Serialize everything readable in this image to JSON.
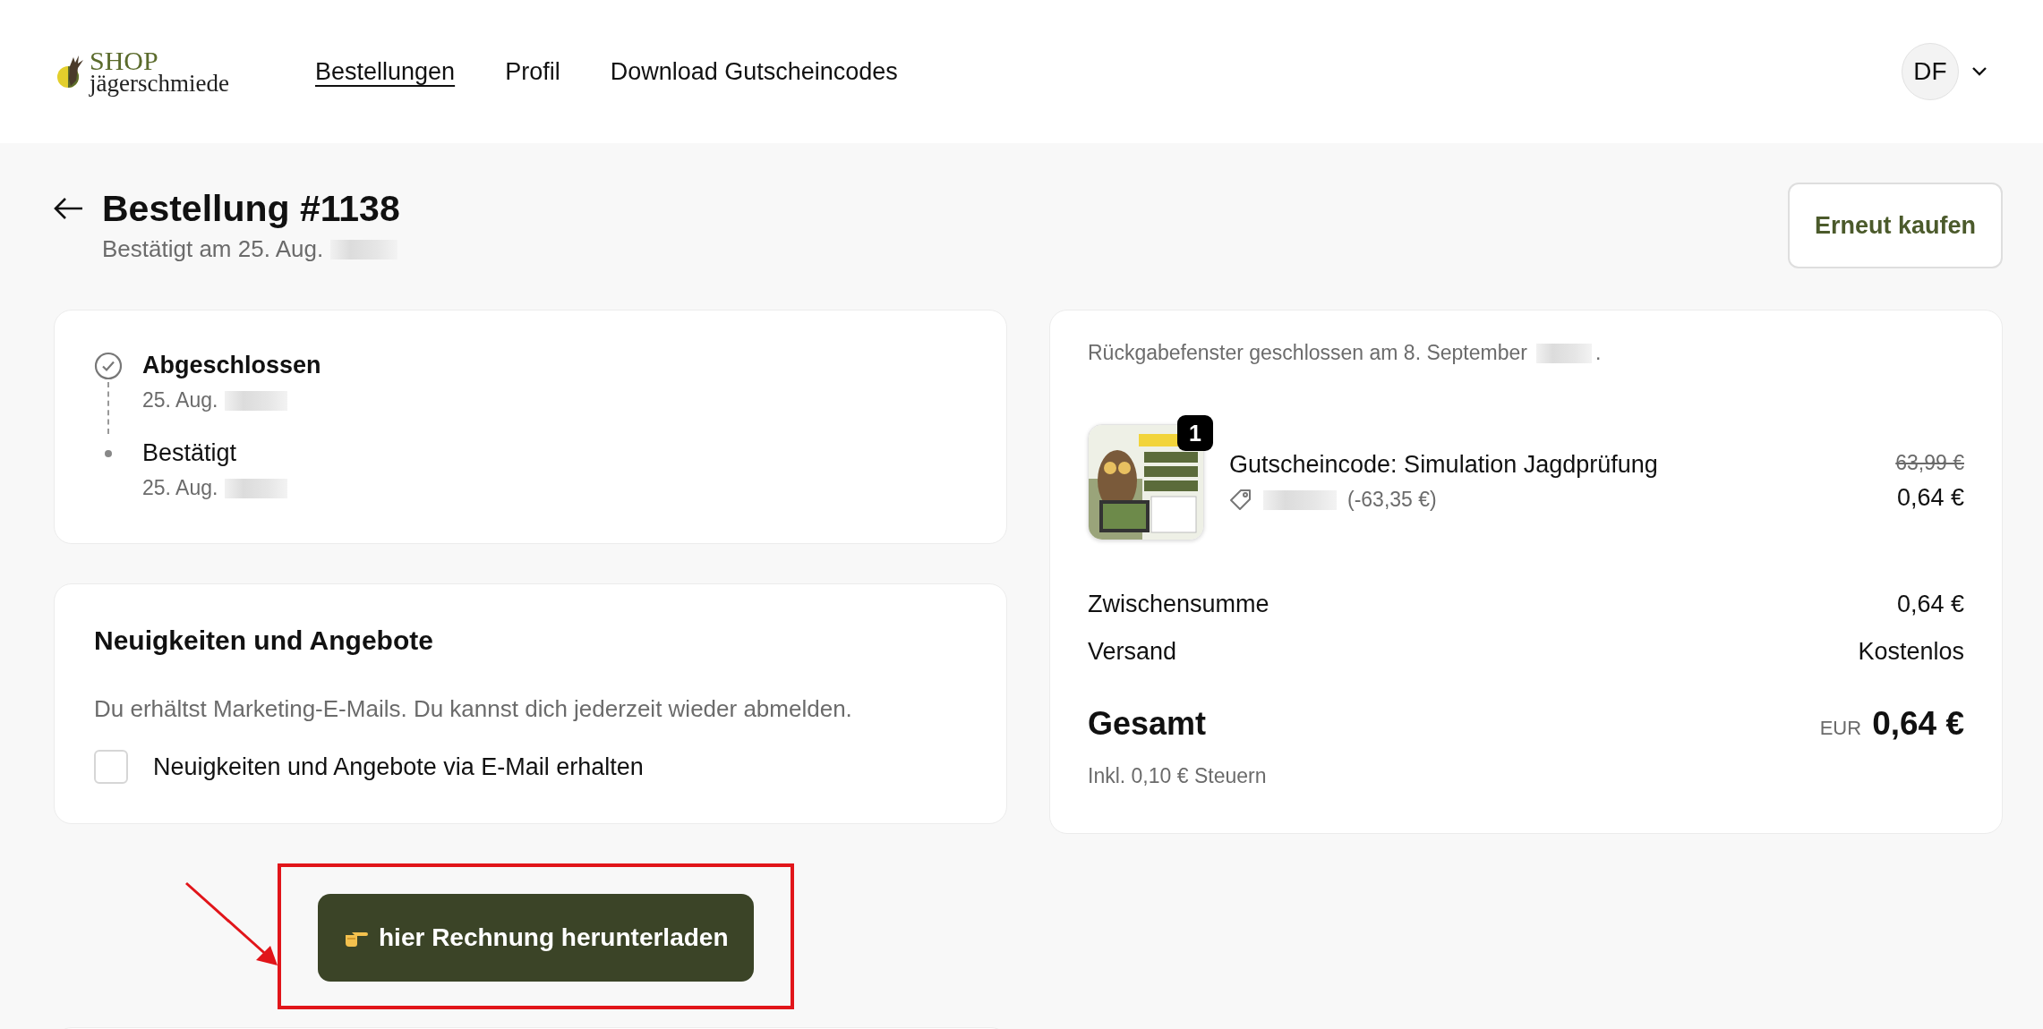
{
  "header": {
    "logo": {
      "top": "SHOP",
      "bottom": "jägerschmiede"
    },
    "nav": [
      {
        "label": "Bestellungen",
        "selected": true
      },
      {
        "label": "Profil",
        "selected": false
      },
      {
        "label": "Download Gutscheincodes",
        "selected": false
      }
    ],
    "account": {
      "initials": "DF"
    }
  },
  "order": {
    "title": "Bestellung #1138",
    "subtitle": "Bestätigt am 25. Aug.",
    "action": "Erneut kaufen"
  },
  "timeline": [
    {
      "kind": "done",
      "label": "Abgeschlossen",
      "date": "25. Aug."
    },
    {
      "kind": "dot",
      "label": "Bestätigt",
      "date": "25. Aug."
    }
  ],
  "newsletter": {
    "title": "Neuigkeiten und Angebote",
    "description": "Du erhältst Marketing-E-Mails. Du kannst dich jederzeit wieder abmelden.",
    "checkbox": {
      "label": "Neuigkeiten und Angebote via E-Mail erhalten",
      "checked": false
    }
  },
  "download_button": "hier Rechnung herunterladen",
  "summary": {
    "return_note": {
      "before": "Rückgabefenster geschlossen am 8. September",
      "after": "."
    },
    "product": {
      "kind": "picture",
      "quantity": "1",
      "name": "Gutscheincode: Simulation Jagdprüfung",
      "discount": "(-63,35 €)",
      "original_price": "63,99 €",
      "price": "0,64 €"
    },
    "rows": [
      {
        "label": "Zwischensumme",
        "value": "0,64 €"
      },
      {
        "label": "Versand",
        "value": "Kostenlos"
      }
    ],
    "total": {
      "label": "Gesamt",
      "currency": "EUR",
      "value": "0,64 €"
    },
    "tax_note": "Inkl. 0,10 € Steuern"
  }
}
